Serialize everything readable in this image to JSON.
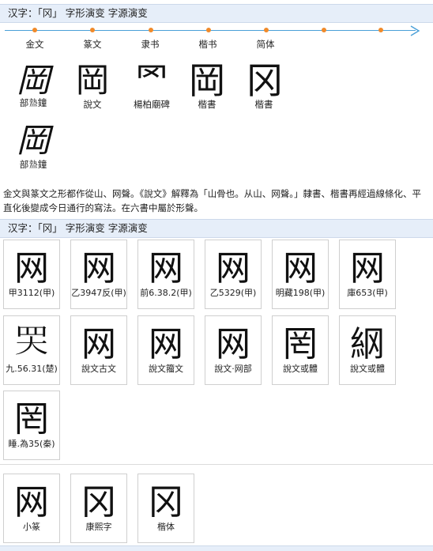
{
  "header1": "汉字：「冈」 字形演变 字源演变",
  "header2": "汉字：「冈」 字形演变 字源演变",
  "timeline": {
    "eras": [
      "金文",
      "篆文",
      "隶书",
      "楷书",
      "简体"
    ],
    "tick_color": "#f08a2a",
    "line_color": "#4aa0d8"
  },
  "evolution": [
    {
      "glyph": "岡",
      "caption": "部𥂕鐘"
    },
    {
      "glyph": "岡",
      "caption": "說文"
    },
    {
      "glyph": "罓",
      "caption": "楊柏廟碑"
    },
    {
      "glyph": "岡",
      "caption": "楷書"
    },
    {
      "glyph": "冈",
      "caption": "楷書"
    },
    {
      "glyph": "岡",
      "caption": "部𥂕鐘"
    }
  ],
  "paragraph": "金文與篆文之形都作從山、网聲。《說文》解釋為「山骨也。从山、网聲。」隸書、楷書再經過線條化、平直化後變成今日通行的寫法。在六書中屬於形聲。",
  "cards_row1": [
    {
      "glyph": "网",
      "label": "甲3112(甲)"
    },
    {
      "glyph": "网",
      "label": "乙3947反(甲)"
    },
    {
      "glyph": "网",
      "label": "前6.38.2(甲)"
    },
    {
      "glyph": "网",
      "label": "乙5329(甲)"
    },
    {
      "glyph": "网",
      "label": "明藏198(甲)"
    },
    {
      "glyph": "网",
      "label": "庫653(甲)"
    }
  ],
  "cards_row2": [
    {
      "glyph": "𦉼",
      "label": "九.56.31(楚)"
    },
    {
      "glyph": "网",
      "label": "說文古文"
    },
    {
      "glyph": "网",
      "label": "說文籀文"
    },
    {
      "glyph": "网",
      "label": "說文·网部"
    },
    {
      "glyph": "罔",
      "label": "說文或體"
    },
    {
      "glyph": "䋄",
      "label": "說文或體"
    }
  ],
  "cards_row3": [
    {
      "glyph": "罔",
      "label": "睡.為35(秦)"
    }
  ],
  "cards_row4": [
    {
      "glyph": "网",
      "label": "小篆"
    },
    {
      "glyph": "冈",
      "label": "康熙字"
    },
    {
      "glyph": "冈",
      "label": "楷体"
    }
  ]
}
